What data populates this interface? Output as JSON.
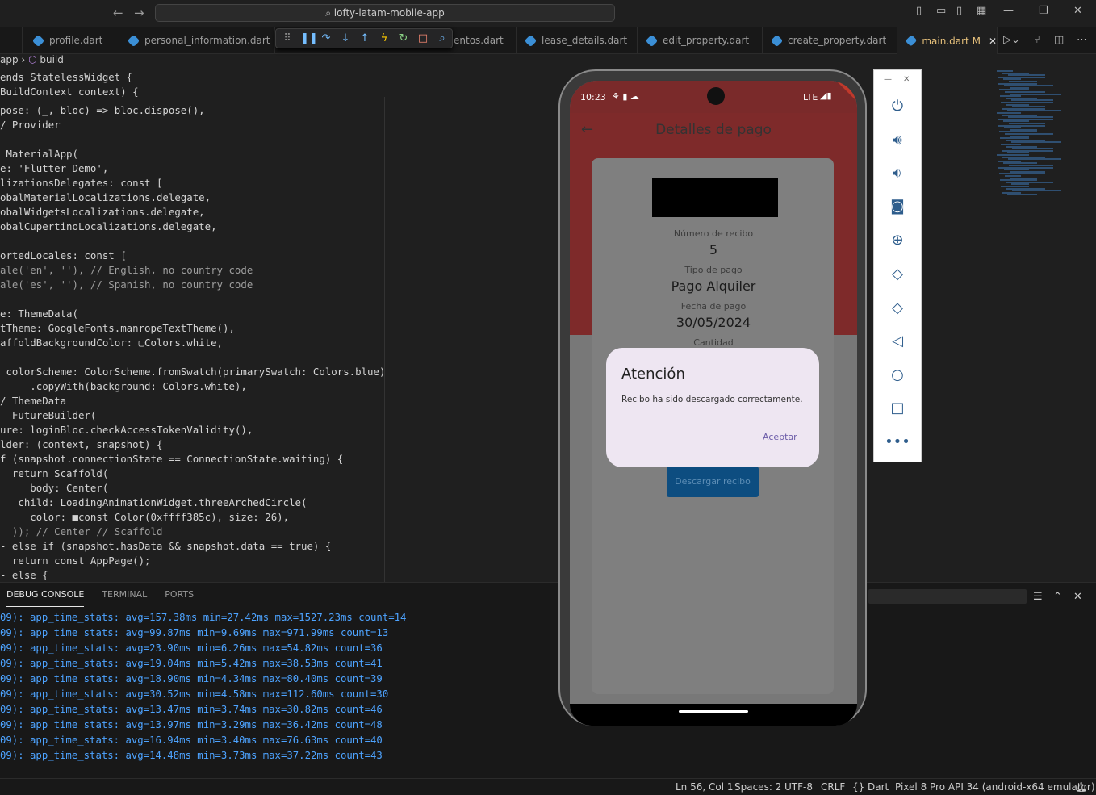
{
  "window": {
    "search": "lofty-latam-mobile-app",
    "back": "←",
    "forward": "→",
    "minimize": "—",
    "restore": "❐",
    "close": "✕"
  },
  "tabs": [
    {
      "label": "profile.dart"
    },
    {
      "label": "personal_information.dart"
    },
    {
      "label": "entos.dart"
    },
    {
      "label": "lease_details.dart"
    },
    {
      "label": "edit_property.dart"
    },
    {
      "label": "create_property.dart"
    },
    {
      "label": "main.dart",
      "modified": "M",
      "close": "✕"
    }
  ],
  "breadcrumb": {
    "folder": "app",
    "sep": "›",
    "symbol": "build"
  },
  "code_lines": [
    "ends StatelessWidget {",
    "BuildContext context) {",
    "pose: (_, bloc) => bloc.dispose(),",
    "/ Provider",
    "",
    " MaterialApp(",
    "e: 'Flutter Demo',",
    "lizationsDelegates: const [",
    "obalMaterialLocalizations.delegate,",
    "obalWidgetsLocalizations.delegate,",
    "obalCupertinoLocalizations.delegate,",
    "",
    "ortedLocales: const [",
    "ale('en', ''), // English, no country code",
    "ale('es', ''), // Spanish, no country code",
    "",
    "e: ThemeData(",
    "tTheme: GoogleFonts.manropeTextTheme(),",
    "affoldBackgroundColor: ▢Colors.white,",
    "",
    " colorScheme: ColorScheme.fromSwatch(primarySwatch: Colors.blue)",
    "     .copyWith(background: Colors.white),",
    "/ ThemeData",
    "  FutureBuilder(",
    "ure: loginBloc.checkAccessTokenValidity(),",
    "lder: (context, snapshot) {",
    "f (snapshot.connectionState == ConnectionState.waiting) {",
    "  return Scaffold(",
    "     body: Center(",
    "   child: LoadingAnimationWidget.threeArchedCircle(",
    "     color: ■const Color(0xffff385c), size: 26),",
    "  )); // Center // Scaffold",
    "- else if (snapshot.hasData && snapshot.data == true) {",
    "  return const AppPage();",
    "- else {"
  ],
  "panel": {
    "tabs": [
      "DEBUG CONSOLE",
      "TERMINAL",
      "PORTS"
    ],
    "lines": [
      "09): app_time_stats: avg=157.38ms min=27.42ms max=1527.23ms count=14",
      "09): app_time_stats: avg=99.87ms min=9.69ms max=971.99ms count=13",
      "09): app_time_stats: avg=23.90ms min=6.26ms max=54.82ms count=36",
      "09): app_time_stats: avg=19.04ms min=5.42ms max=38.53ms count=41",
      "09): app_time_stats: avg=18.90ms min=4.34ms max=80.40ms count=39",
      "09): app_time_stats: avg=30.52ms min=4.58ms max=112.60ms count=30",
      "09): app_time_stats: avg=13.47ms min=3.74ms max=30.82ms count=46",
      "09): app_time_stats: avg=13.97ms min=3.29ms max=36.42ms count=48",
      "09): app_time_stats: avg=16.94ms min=3.40ms max=76.63ms count=40",
      "09): app_time_stats: avg=14.48ms min=3.73ms max=37.22ms count=43"
    ]
  },
  "status": {
    "position": "Ln 56, Col 1",
    "spaces": "Spaces: 2",
    "encoding": "UTF-8",
    "eol": "CRLF",
    "language": "Dart",
    "device": "Pixel 8 Pro API 34 (android-x64 emulator)"
  },
  "phone": {
    "time": "10:23",
    "network": "LTE",
    "debug_banner": "DEBUG",
    "app_title": "Detalles de pago",
    "back_icon": "←",
    "fields": [
      {
        "label": "Número de recibo",
        "value": "5"
      },
      {
        "label": "Tipo de pago",
        "value": "Pago Alquiler"
      },
      {
        "label": "Fecha de pago",
        "value": "30/05/2024"
      },
      {
        "label": "Cantidad",
        "value": ""
      }
    ],
    "download_button": "Descargar recibo",
    "dialog": {
      "title": "Atención",
      "message": "Recibo ha sido descargado correctamente.",
      "button": "Aceptar"
    }
  },
  "emulator_tools": {
    "minimize": "—",
    "close": "✕"
  },
  "colors": {
    "accent": "#0078d4",
    "app_bar": "#7e2a2a",
    "button": "#0d4d80",
    "dialog_bg": "#eee6f2",
    "dialog_action": "#6b5ba8"
  }
}
